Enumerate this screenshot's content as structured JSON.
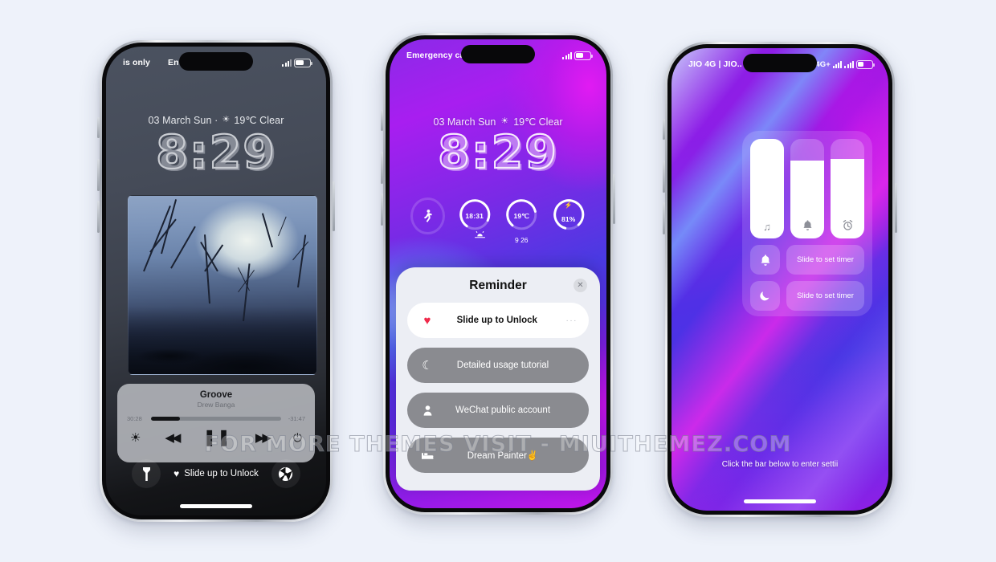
{
  "page": {
    "background": "#eef2fa",
    "watermark": "FOR MORE THEMES VISIT - MIUITHEMEZ.COM"
  },
  "phone1": {
    "status": {
      "carrier_left": "is only",
      "carrier_right": "En",
      "signal_icon": "signal-bars-icon",
      "battery_icon": "battery-icon"
    },
    "weather": {
      "date": "03 March Sun ·",
      "sun_icon": "☀",
      "temp": "19℃ Clear"
    },
    "clock": {
      "hours": "8",
      "sep": ":",
      "minutes": "29",
      "display": "8:29"
    },
    "album": {
      "art_name": "winter-trees-painting"
    },
    "music": {
      "title": "Groove",
      "artist": "Drew Banga",
      "elapsed": "30:28",
      "remaining": "-31:47",
      "progress_percent": 22,
      "brightness_icon": "☀",
      "prev_icon": "◀◀",
      "play_icon": "❚❚",
      "next_icon": "▶▶",
      "power_icon": "⏻"
    },
    "bottom": {
      "flashlight_icon": "flashlight-icon",
      "heart_icon": "♥",
      "unlock_label": "Slide up to Unlock",
      "camera_icon": "camera-shutter-icon"
    }
  },
  "phone2": {
    "status": {
      "carrier": "Emergency ca",
      "signal_icon": "signal-bars-icon",
      "battery_icon": "battery-icon"
    },
    "weather": {
      "date": "03 March Sun",
      "sun_icon": "☀",
      "temp": "19℃ Clear"
    },
    "clock": {
      "hours": "8",
      "sep": ":",
      "minutes": "29",
      "display": "8:29"
    },
    "rings": [
      {
        "name": "steps",
        "icon": "walking-person-icon",
        "label": "",
        "sub": "",
        "progress": 0
      },
      {
        "name": "sunset",
        "label": "18:31",
        "sub": "",
        "icon": "sunset-icon",
        "progress": 72
      },
      {
        "name": "temperature",
        "label": "19℃",
        "sub": "9   26",
        "icon": "",
        "progress": 60
      },
      {
        "name": "battery",
        "label": "81%",
        "sub": "",
        "icon": "⚡",
        "progress": 81
      }
    ],
    "reminder": {
      "title": "Reminder",
      "close_icon": "✕",
      "rows": [
        {
          "icon": "♥",
          "icon_name": "heart-icon",
          "label": "Slide up to Unlock",
          "style": "white",
          "trailing": "···"
        },
        {
          "icon": "☾",
          "icon_name": "moon-icon",
          "label": "Detailed usage tutorial",
          "style": "grey",
          "trailing": ""
        },
        {
          "icon": "👤",
          "icon_name": "person-icon",
          "label": "WeChat public account",
          "style": "grey",
          "trailing": ""
        },
        {
          "icon": "🛏",
          "icon_name": "bed-icon",
          "label": "Dream Painter✌",
          "style": "grey",
          "trailing": ""
        }
      ]
    }
  },
  "phone3": {
    "status": {
      "carrier": "JIO 4G | JIO..",
      "network": "4G+",
      "eye_icon": "◎",
      "signal_icon": "signal-bars-icon",
      "battery_icon": "battery-icon",
      "battery_level": "42"
    },
    "control": {
      "sliders": [
        {
          "name": "music-volume",
          "icon": "♫",
          "icon_name": "music-note-icon",
          "level": 100
        },
        {
          "name": "ring-volume",
          "icon": "🔔",
          "icon_name": "bell-icon",
          "level": 78
        },
        {
          "name": "alarm-volume",
          "icon": "⏰",
          "icon_name": "alarm-clock-icon",
          "level": 80
        }
      ],
      "timers": [
        {
          "name": "ring-timer",
          "icon": "🔔",
          "icon_name": "bell-icon",
          "label": "Slide to set timer"
        },
        {
          "name": "sleep-timer",
          "icon": "☾",
          "icon_name": "moon-icon",
          "label": "Slide to set timer"
        }
      ]
    },
    "hint": "Click the bar below to enter settii"
  }
}
